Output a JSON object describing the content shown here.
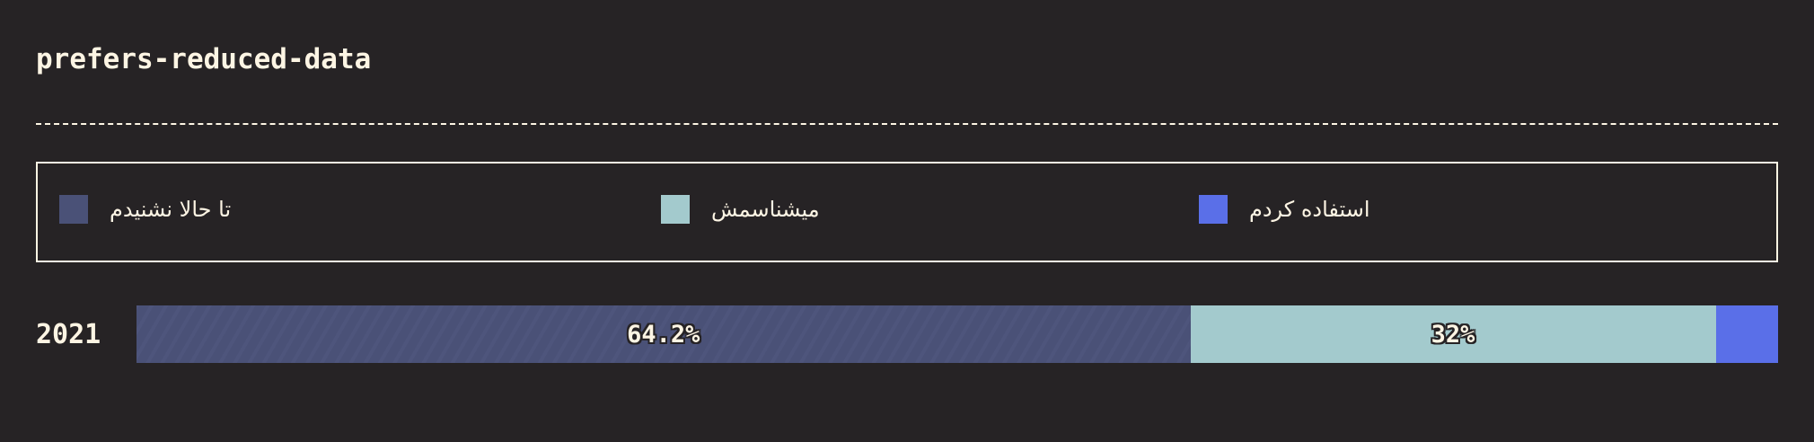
{
  "title": "prefers-reduced-data",
  "chart_data": {
    "type": "bar",
    "orientation": "horizontal-stacked",
    "title": "prefers-reduced-data",
    "categories": [
      "2021"
    ],
    "series": [
      {
        "name": "تا حالا نشنیدم",
        "values": [
          64.2
        ],
        "label": "64.2%",
        "color": "#4a5177",
        "pattern": "hatched"
      },
      {
        "name": "میشناسمش",
        "values": [
          32
        ],
        "label": "32%",
        "color": "#a3cacd"
      },
      {
        "name": "استفاده کردم",
        "values": [
          3.8
        ],
        "label": "",
        "color": "#5a6fe8"
      }
    ],
    "xlim": [
      0,
      100
    ],
    "legend": "top"
  }
}
